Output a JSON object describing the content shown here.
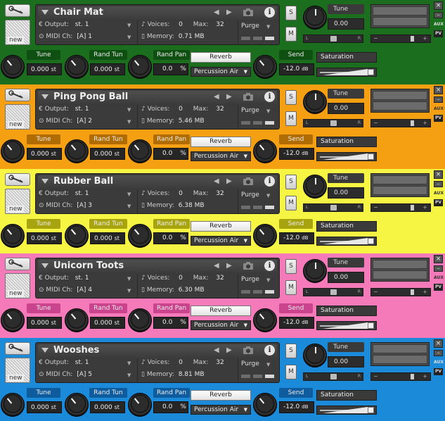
{
  "common": {
    "output_label": "Output:",
    "output_value": "st. 1",
    "midi_label": "MIDI Ch:",
    "voices_label": "Voices:",
    "voices_value": "0",
    "max_label": "Max:",
    "max_value": "32",
    "memory_label": "Memory:",
    "purge_label": "Purge",
    "tune_label": "Tune",
    "tune_value": "0.00",
    "rand_tun_label": "Rand Tun",
    "rand_pan_label": "Rand Pan",
    "send_label": "Send",
    "reverb_label": "Reverb",
    "percussion_label": "Percussion Air",
    "saturation_label": "Saturation",
    "s_button": "S",
    "m_button": "M",
    "new_label": "new",
    "info_label": "i",
    "aux_label": "AUX",
    "pv_label": "PV",
    "close_label": "×",
    "minus_label": "−",
    "plus_label": "+",
    "l_label": "L",
    "r_label": "R",
    "bottom_tune_value": "0.000",
    "rand_tun_value": "0.000",
    "rand_pan_value": "0.0",
    "pan_unit": "%",
    "st_unit": "st",
    "send_value": "-12.0",
    "db_unit": "dB"
  },
  "racks": [
    {
      "name": "Chair Mat",
      "midi": "[A]  1",
      "memory": "0.71 MB",
      "color": "#1b6e1e",
      "label_bg": "#0f4f12",
      "light": false
    },
    {
      "name": "Ping Pong Ball",
      "midi": "[A]  2",
      "memory": "5.46 MB",
      "color": "#f5a013",
      "label_bg": "#b06c00",
      "light": true
    },
    {
      "name": "Rubber Ball",
      "midi": "[A]  3",
      "memory": "6.38 MB",
      "color": "#f7f544",
      "label_bg": "#a8a410",
      "light": true
    },
    {
      "name": "Unicorn Toots",
      "midi": "[A]  4",
      "memory": "6.30 MB",
      "color": "#f57aba",
      "label_bg": "#c9438d",
      "light": true
    },
    {
      "name": "Wooshes",
      "midi": "[A]  5",
      "memory": "8.81 MB",
      "color": "#1b8ad8",
      "label_bg": "#0e5c9e",
      "light": false
    }
  ]
}
